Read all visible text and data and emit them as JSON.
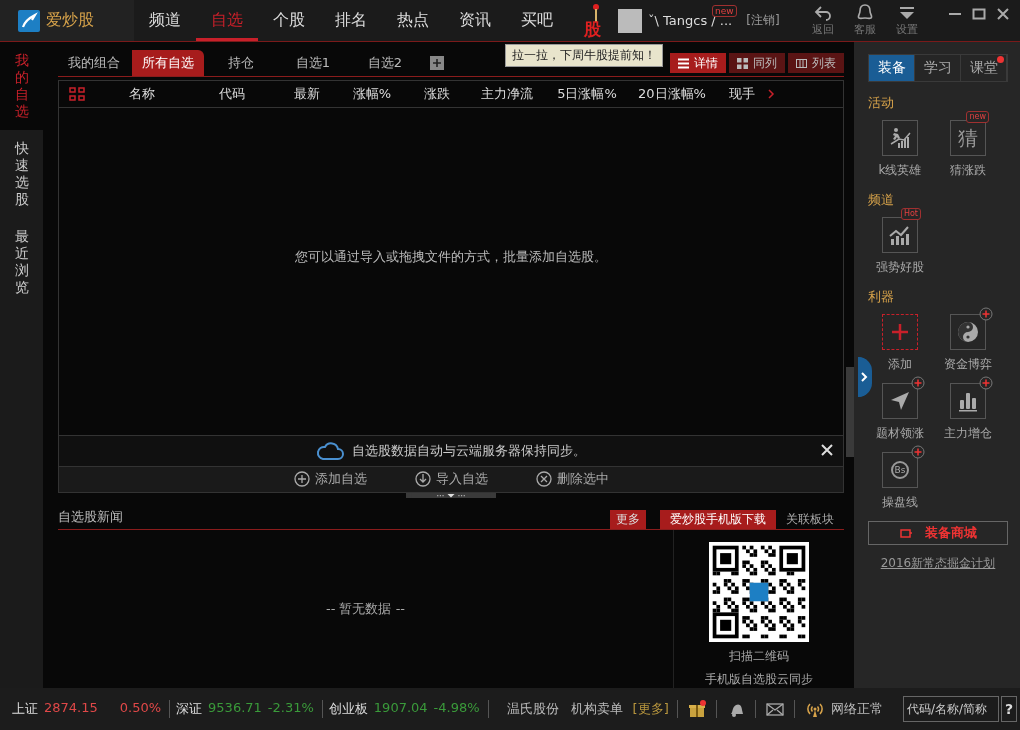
{
  "app": {
    "logo_text": "爱炒股"
  },
  "nav": [
    {
      "label": "频道",
      "selected": false
    },
    {
      "label": "自选",
      "selected": true
    },
    {
      "label": "个股",
      "selected": false
    },
    {
      "label": "排名",
      "selected": false
    },
    {
      "label": "热点",
      "selected": false
    },
    {
      "label": "资讯",
      "selected": false
    },
    {
      "label": "买吧",
      "selected": false
    }
  ],
  "promo": {
    "badge_text": "股",
    "tooltip": "拉一拉，下周牛股提前知！"
  },
  "user": {
    "name": "ˇ\\ Tangcs / ...",
    "badge": "new",
    "logout": "[注销]"
  },
  "toolbar": [
    {
      "label": "返回",
      "kind": "back"
    },
    {
      "label": "客服",
      "kind": "support"
    },
    {
      "label": "设置",
      "kind": "settings"
    }
  ],
  "left_rail": [
    {
      "label": "我的自选",
      "selected": true
    },
    {
      "label": "快速选股",
      "selected": false
    },
    {
      "label": "最近浏览",
      "selected": false
    }
  ],
  "sub_tabs": [
    {
      "label": "我的组合",
      "selected": false
    },
    {
      "label": "所有自选",
      "selected": true
    },
    {
      "label": "持仓",
      "selected": false
    },
    {
      "label": "自选1",
      "selected": false
    },
    {
      "label": "自选2",
      "selected": false
    }
  ],
  "view_modes": [
    {
      "label": "详情",
      "kind": "details",
      "selected": true
    },
    {
      "label": "同列",
      "kind": "grid",
      "selected": false
    },
    {
      "label": "列表",
      "kind": "columns",
      "selected": false
    }
  ],
  "table": {
    "columns": [
      "名称",
      "代码",
      "最新",
      "涨幅%",
      "涨跌",
      "主力净流",
      "5日涨幅%",
      "20日涨幅%",
      "现手"
    ],
    "empty_message": "您可以通过导入或拖拽文件的方式，批量添加自选股。"
  },
  "sync_notice": {
    "text": "自选股数据自动与云端服务器保持同步。"
  },
  "actions": [
    {
      "label": "添加自选",
      "kind": "add"
    },
    {
      "label": "导入自选",
      "kind": "import"
    },
    {
      "label": "删除选中",
      "kind": "delete"
    }
  ],
  "news": {
    "title": "自选股新闻",
    "more": "更多",
    "tabs": [
      {
        "label": "爱炒股手机版下载",
        "selected": true
      },
      {
        "label": "关联板块",
        "selected": false
      }
    ],
    "empty": "-- 暂无数据 --",
    "qr_caption": "扫描二维码",
    "qr_subcaption": "手机版自选股云同步"
  },
  "right_panel": {
    "tabs": [
      {
        "label": "装备",
        "selected": true,
        "dot": false
      },
      {
        "label": "学习",
        "selected": false,
        "dot": false
      },
      {
        "label": "课堂",
        "selected": false,
        "dot": true
      }
    ],
    "sections": [
      {
        "title": "活动",
        "tools": [
          {
            "label": "k线英雄",
            "kind": "hero",
            "addable": false
          },
          {
            "label": "猜涨跌",
            "kind": "glyph",
            "glyph": "猜",
            "badge": "new",
            "addable": false
          }
        ]
      },
      {
        "title": "频道",
        "tools": [
          {
            "label": "强势好股",
            "kind": "trend",
            "badge": "Hot",
            "addable": false
          }
        ]
      },
      {
        "title": "利器",
        "tools": [
          {
            "label": "添加",
            "kind": "add",
            "addable": false
          },
          {
            "label": "资金博弈",
            "kind": "yinyang",
            "addable": true
          },
          {
            "label": "题材领涨",
            "kind": "pointer",
            "addable": true
          },
          {
            "label": "主力增仓",
            "kind": "bars",
            "addable": true
          },
          {
            "label": "操盘线",
            "kind": "cycle",
            "glyph": "Bs",
            "addable": true
          }
        ]
      }
    ],
    "store_button": "装备商城",
    "link": "2016新常态掘金计划"
  },
  "status_bar": {
    "tickers": [
      {
        "name": "上证",
        "value": "2874.15",
        "change": "0.50%",
        "up": true
      },
      {
        "name": "深证",
        "value": "9536.71",
        "change": "-2.31%",
        "up": false
      },
      {
        "name": "创业板",
        "value": "1907.04",
        "change": "-4.98%",
        "up": false
      }
    ],
    "stock": "温氏股份",
    "feed": "机构卖单",
    "more": "[更多]",
    "network": "网络正常",
    "search_placeholder": "代码/名称/简称",
    "help": "?"
  }
}
